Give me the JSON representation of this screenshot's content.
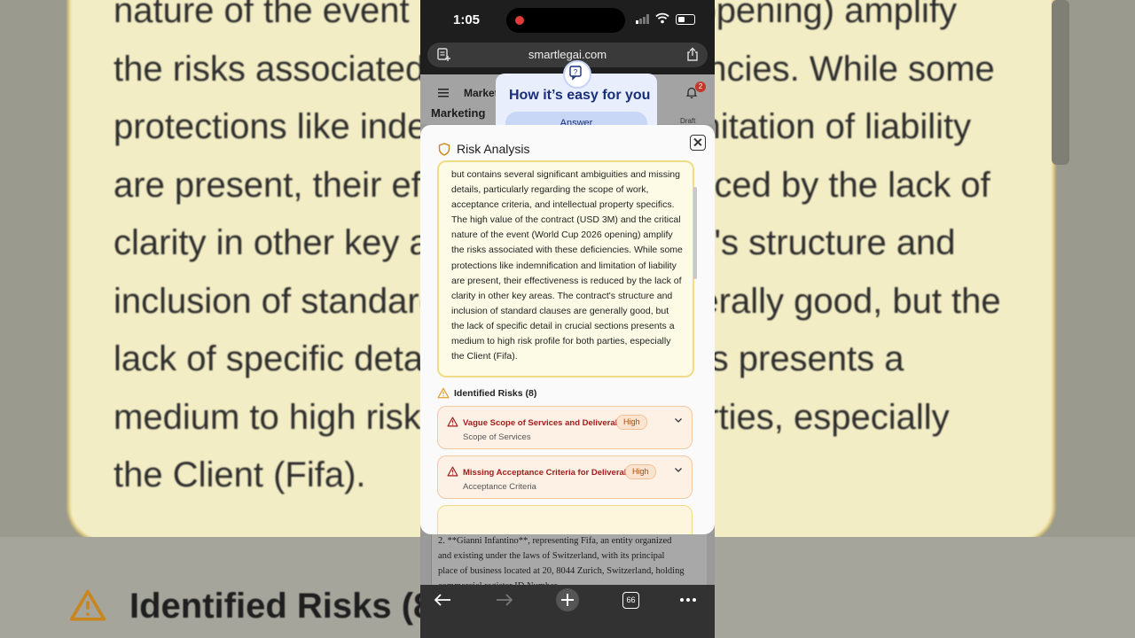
{
  "background": {
    "lines": [
      "nature of the event (World Cup 2026 opening) amplify",
      "the risks associated with these deficiencies. While some",
      "protections like indemnification and limitation of liability",
      "are present, their effectiveness is reduced by the lack of",
      "clarity in other key areas. The contract's structure and",
      "inclusion of standard clauses are generally good, but the",
      "lack of specific detail in crucial sections presents a",
      "medium to high risk profile for both parties, especially",
      "the Client (Fifa)."
    ],
    "risks_title": "Identified Risks (8)"
  },
  "status": {
    "time": "1:05"
  },
  "browser": {
    "url": "smartlegai.com",
    "tab_count": "66"
  },
  "page": {
    "header_title": "Market",
    "title2": "Marketing",
    "notification_count": "2",
    "draft_label": "Draft",
    "doc_text": "2.  **Gianni Infantino**, representing Fifa, an entity organized and existing under the laws of Switzerland, with its principal place of business located at 20, 8044 Zurich, Switzerland, holding commercial register ID Number"
  },
  "tooltip": {
    "title": "How it’s easy for you",
    "button": "Answer"
  },
  "modal": {
    "title": "Risk Analysis",
    "summary": "but contains several significant ambiguities and missing details, particularly regarding the scope of work, acceptance criteria, and intellectual property specifics. The high value of the contract (USD 3M) and the critical nature of the event (World Cup 2026 opening) amplify the risks associated with these deficiencies. While some protections like indemnification and limitation of liability are present, their effectiveness is reduced by the lack of clarity in other key areas. The contract's structure and inclusion of standard clauses are generally good, but the lack of specific detail in crucial sections presents a medium to high risk profile for both parties, especially the Client (Fifa).",
    "risks_title": "Identified Risks (8)",
    "risks": [
      {
        "title": "Vague Scope of Services and Deliverables",
        "severity": "High",
        "category": "Scope of Services"
      },
      {
        "title": "Missing Acceptance Criteria for Deliverables",
        "severity": "High",
        "category": "Acceptance Criteria"
      }
    ]
  },
  "colors": {
    "accent": "#1a2f7a",
    "risk_high": "#a11d1d",
    "summary_bg": "#fdfbe6"
  }
}
